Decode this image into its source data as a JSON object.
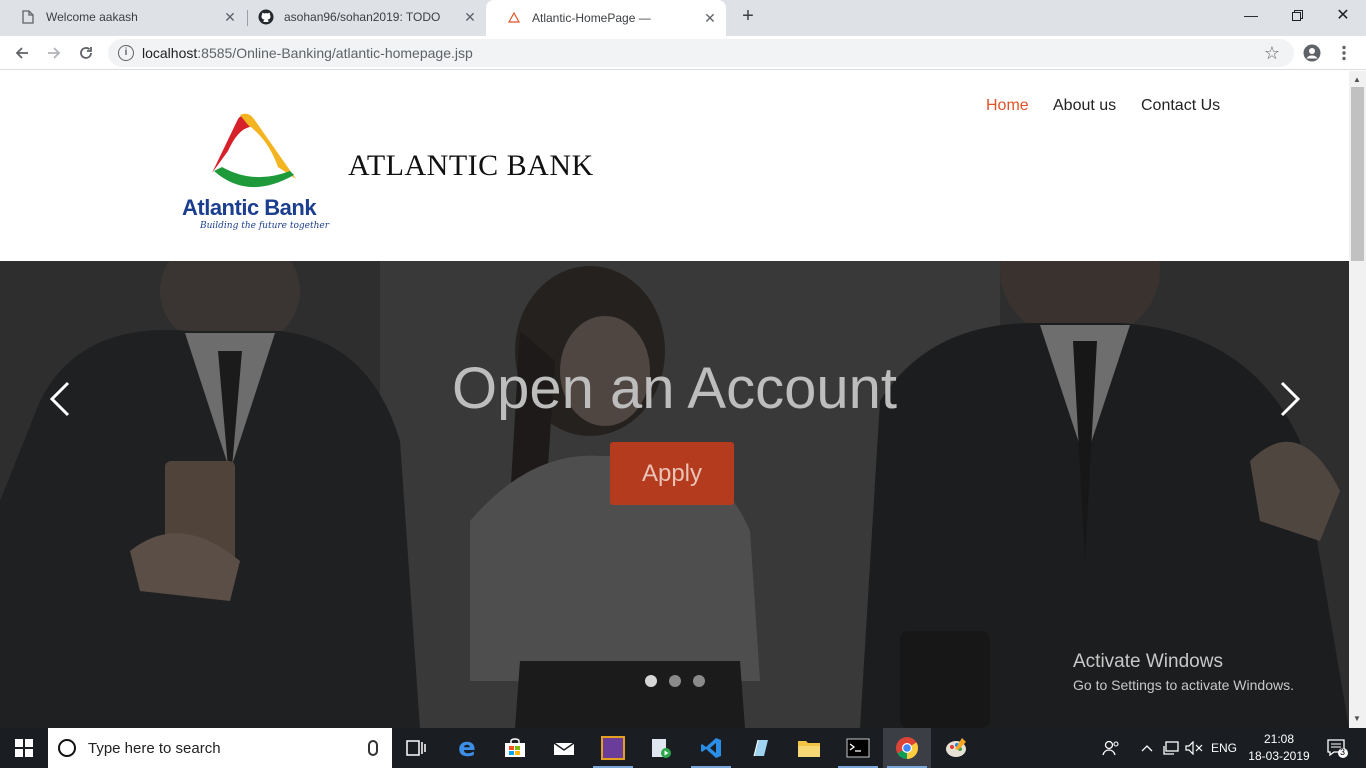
{
  "browser": {
    "tabs": [
      {
        "title": "Welcome aakash",
        "icon": "page-icon"
      },
      {
        "title": "asohan96/sohan2019: TODO",
        "icon": "github-icon"
      },
      {
        "title": "Atlantic-HomePage —",
        "icon": "loading-icon"
      }
    ],
    "url_host": "localhost",
    "url_rest": ":8585/Online-Banking/atlantic-homepage.jsp"
  },
  "site": {
    "logo_name": "Atlantic Bank",
    "logo_tagline": "Building the future together",
    "bank_title": "ATLANTIC BANK",
    "nav": [
      "Home",
      "About us",
      "Contact Us"
    ],
    "nav_active_color": "#e0532a",
    "hero_heading": "Open an Account",
    "apply_label": "Apply",
    "carousel_prev": "‹",
    "carousel_next": "›",
    "active_slide": 1,
    "slide_count": 3
  },
  "watermark": {
    "line1": "Activate Windows",
    "line2": "Go to Settings to activate Windows."
  },
  "taskbar": {
    "search_placeholder": "Type here to search",
    "language": "ENG",
    "time": "21:08",
    "date": "18-03-2019",
    "notification_count": "3"
  }
}
